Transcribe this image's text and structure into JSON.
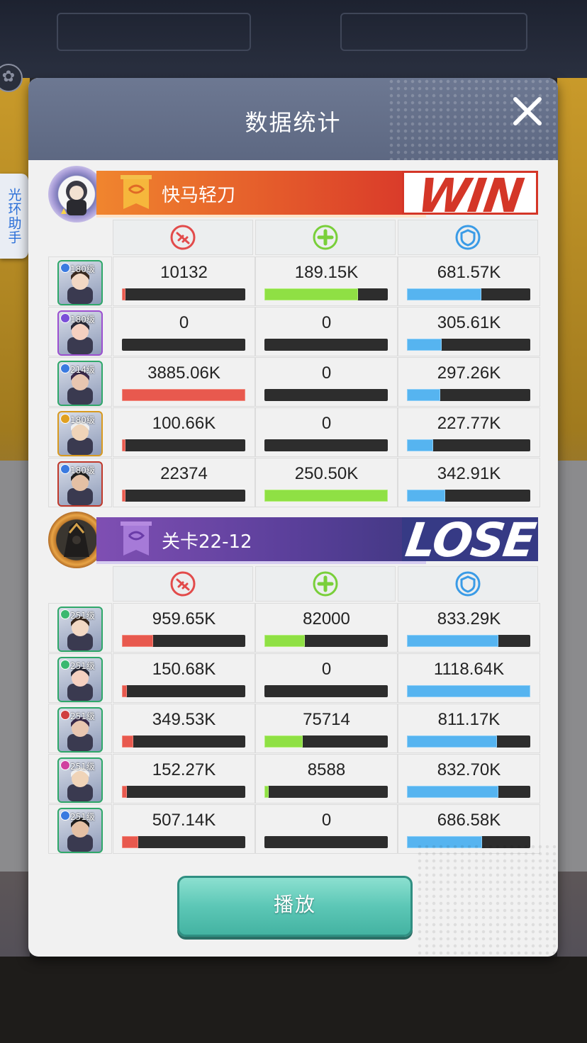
{
  "side_tab": {
    "label": "光环助手"
  },
  "modal": {
    "title": "数据统计"
  },
  "team1": {
    "name": "快马轻刀",
    "result": "WIN",
    "heroes": [
      {
        "level": "180级",
        "elem_color": "#3a7ae0",
        "frame": "#2fa86a",
        "dmg": "10132",
        "dmg_pct": 0.003,
        "heal": "189.15K",
        "heal_pct": 0.756,
        "tank": "681.57K",
        "tank_pct": 0.605
      },
      {
        "level": "180级",
        "elem_color": "#7a4fd8",
        "frame": "#9b4fd0",
        "dmg": "0",
        "dmg_pct": 0,
        "heal": "0",
        "heal_pct": 0,
        "tank": "305.61K",
        "tank_pct": 0.28
      },
      {
        "level": "214级",
        "elem_color": "#3a7ae0",
        "frame": "#2fa86a",
        "dmg": "3885.06K",
        "dmg_pct": 1.0,
        "heal": "0",
        "heal_pct": 0,
        "tank": "297.26K",
        "tank_pct": 0.27
      },
      {
        "level": "180级",
        "elem_color": "#e0a020",
        "frame": "#d89a20",
        "dmg": "100.66K",
        "dmg_pct": 0.03,
        "heal": "0",
        "heal_pct": 0,
        "tank": "227.77K",
        "tank_pct": 0.21
      },
      {
        "level": "180级",
        "elem_color": "#3a7ae0",
        "frame": "#c0392b",
        "dmg": "22374",
        "dmg_pct": 0.006,
        "heal": "250.50K",
        "heal_pct": 1.0,
        "tank": "342.91K",
        "tank_pct": 0.31
      }
    ]
  },
  "team2": {
    "name": "关卡22-12",
    "result": "LOSE",
    "heroes": [
      {
        "level": "251级",
        "elem_color": "#3ab870",
        "frame": "#2fa86a",
        "dmg": "959.65K",
        "dmg_pct": 0.25,
        "heal": "82000",
        "heal_pct": 0.33,
        "tank": "833.29K",
        "tank_pct": 0.74
      },
      {
        "level": "251级",
        "elem_color": "#3ab870",
        "frame": "#2fa86a",
        "dmg": "150.68K",
        "dmg_pct": 0.04,
        "heal": "0",
        "heal_pct": 0,
        "tank": "1118.64K",
        "tank_pct": 1.0
      },
      {
        "level": "251级",
        "elem_color": "#d04040",
        "frame": "#2fa86a",
        "dmg": "349.53K",
        "dmg_pct": 0.09,
        "heal": "75714",
        "heal_pct": 0.31,
        "tank": "811.17K",
        "tank_pct": 0.73
      },
      {
        "level": "251级",
        "elem_color": "#d040a0",
        "frame": "#2fa86a",
        "dmg": "152.27K",
        "dmg_pct": 0.04,
        "heal": "8588",
        "heal_pct": 0.035,
        "tank": "832.70K",
        "tank_pct": 0.74
      },
      {
        "level": "251级",
        "elem_color": "#3a7ae0",
        "frame": "#2fa86a",
        "dmg": "507.14K",
        "dmg_pct": 0.13,
        "heal": "0",
        "heal_pct": 0,
        "tank": "686.58K",
        "tank_pct": 0.61
      }
    ]
  },
  "columns": [
    {
      "icon": "damage-icon",
      "color": "#e24b4b"
    },
    {
      "icon": "heal-icon",
      "color": "#79cf3a"
    },
    {
      "icon": "shield-icon",
      "color": "#3a9be6"
    }
  ],
  "play_button": {
    "label": "播放"
  }
}
